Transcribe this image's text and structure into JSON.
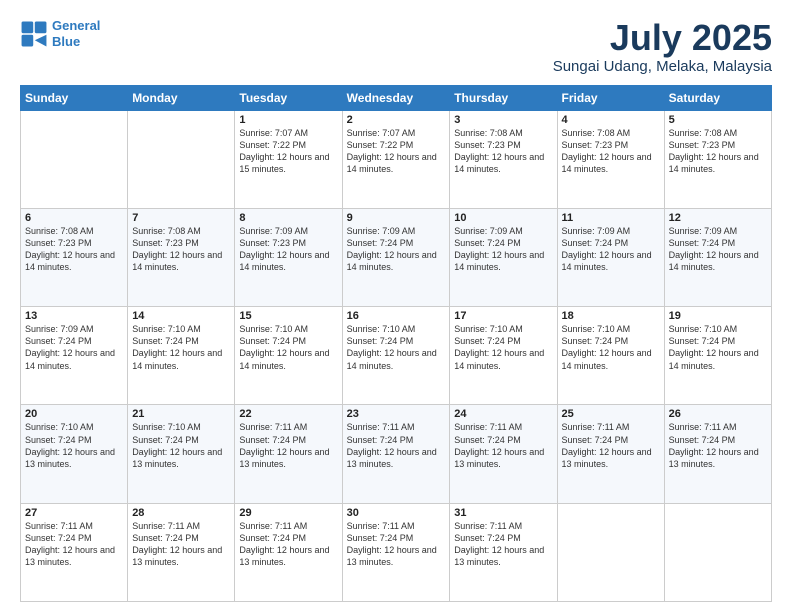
{
  "logo": {
    "line1": "General",
    "line2": "Blue"
  },
  "header": {
    "month": "July 2025",
    "location": "Sungai Udang, Melaka, Malaysia"
  },
  "weekdays": [
    "Sunday",
    "Monday",
    "Tuesday",
    "Wednesday",
    "Thursday",
    "Friday",
    "Saturday"
  ],
  "weeks": [
    [
      {
        "day": "",
        "detail": ""
      },
      {
        "day": "",
        "detail": ""
      },
      {
        "day": "1",
        "detail": "Sunrise: 7:07 AM\nSunset: 7:22 PM\nDaylight: 12 hours and 15 minutes."
      },
      {
        "day": "2",
        "detail": "Sunrise: 7:07 AM\nSunset: 7:22 PM\nDaylight: 12 hours and 14 minutes."
      },
      {
        "day": "3",
        "detail": "Sunrise: 7:08 AM\nSunset: 7:23 PM\nDaylight: 12 hours and 14 minutes."
      },
      {
        "day": "4",
        "detail": "Sunrise: 7:08 AM\nSunset: 7:23 PM\nDaylight: 12 hours and 14 minutes."
      },
      {
        "day": "5",
        "detail": "Sunrise: 7:08 AM\nSunset: 7:23 PM\nDaylight: 12 hours and 14 minutes."
      }
    ],
    [
      {
        "day": "6",
        "detail": "Sunrise: 7:08 AM\nSunset: 7:23 PM\nDaylight: 12 hours and 14 minutes."
      },
      {
        "day": "7",
        "detail": "Sunrise: 7:08 AM\nSunset: 7:23 PM\nDaylight: 12 hours and 14 minutes."
      },
      {
        "day": "8",
        "detail": "Sunrise: 7:09 AM\nSunset: 7:23 PM\nDaylight: 12 hours and 14 minutes."
      },
      {
        "day": "9",
        "detail": "Sunrise: 7:09 AM\nSunset: 7:24 PM\nDaylight: 12 hours and 14 minutes."
      },
      {
        "day": "10",
        "detail": "Sunrise: 7:09 AM\nSunset: 7:24 PM\nDaylight: 12 hours and 14 minutes."
      },
      {
        "day": "11",
        "detail": "Sunrise: 7:09 AM\nSunset: 7:24 PM\nDaylight: 12 hours and 14 minutes."
      },
      {
        "day": "12",
        "detail": "Sunrise: 7:09 AM\nSunset: 7:24 PM\nDaylight: 12 hours and 14 minutes."
      }
    ],
    [
      {
        "day": "13",
        "detail": "Sunrise: 7:09 AM\nSunset: 7:24 PM\nDaylight: 12 hours and 14 minutes."
      },
      {
        "day": "14",
        "detail": "Sunrise: 7:10 AM\nSunset: 7:24 PM\nDaylight: 12 hours and 14 minutes."
      },
      {
        "day": "15",
        "detail": "Sunrise: 7:10 AM\nSunset: 7:24 PM\nDaylight: 12 hours and 14 minutes."
      },
      {
        "day": "16",
        "detail": "Sunrise: 7:10 AM\nSunset: 7:24 PM\nDaylight: 12 hours and 14 minutes."
      },
      {
        "day": "17",
        "detail": "Sunrise: 7:10 AM\nSunset: 7:24 PM\nDaylight: 12 hours and 14 minutes."
      },
      {
        "day": "18",
        "detail": "Sunrise: 7:10 AM\nSunset: 7:24 PM\nDaylight: 12 hours and 14 minutes."
      },
      {
        "day": "19",
        "detail": "Sunrise: 7:10 AM\nSunset: 7:24 PM\nDaylight: 12 hours and 14 minutes."
      }
    ],
    [
      {
        "day": "20",
        "detail": "Sunrise: 7:10 AM\nSunset: 7:24 PM\nDaylight: 12 hours and 13 minutes."
      },
      {
        "day": "21",
        "detail": "Sunrise: 7:10 AM\nSunset: 7:24 PM\nDaylight: 12 hours and 13 minutes."
      },
      {
        "day": "22",
        "detail": "Sunrise: 7:11 AM\nSunset: 7:24 PM\nDaylight: 12 hours and 13 minutes."
      },
      {
        "day": "23",
        "detail": "Sunrise: 7:11 AM\nSunset: 7:24 PM\nDaylight: 12 hours and 13 minutes."
      },
      {
        "day": "24",
        "detail": "Sunrise: 7:11 AM\nSunset: 7:24 PM\nDaylight: 12 hours and 13 minutes."
      },
      {
        "day": "25",
        "detail": "Sunrise: 7:11 AM\nSunset: 7:24 PM\nDaylight: 12 hours and 13 minutes."
      },
      {
        "day": "26",
        "detail": "Sunrise: 7:11 AM\nSunset: 7:24 PM\nDaylight: 12 hours and 13 minutes."
      }
    ],
    [
      {
        "day": "27",
        "detail": "Sunrise: 7:11 AM\nSunset: 7:24 PM\nDaylight: 12 hours and 13 minutes."
      },
      {
        "day": "28",
        "detail": "Sunrise: 7:11 AM\nSunset: 7:24 PM\nDaylight: 12 hours and 13 minutes."
      },
      {
        "day": "29",
        "detail": "Sunrise: 7:11 AM\nSunset: 7:24 PM\nDaylight: 12 hours and 13 minutes."
      },
      {
        "day": "30",
        "detail": "Sunrise: 7:11 AM\nSunset: 7:24 PM\nDaylight: 12 hours and 13 minutes."
      },
      {
        "day": "31",
        "detail": "Sunrise: 7:11 AM\nSunset: 7:24 PM\nDaylight: 12 hours and 13 minutes."
      },
      {
        "day": "",
        "detail": ""
      },
      {
        "day": "",
        "detail": ""
      }
    ]
  ]
}
